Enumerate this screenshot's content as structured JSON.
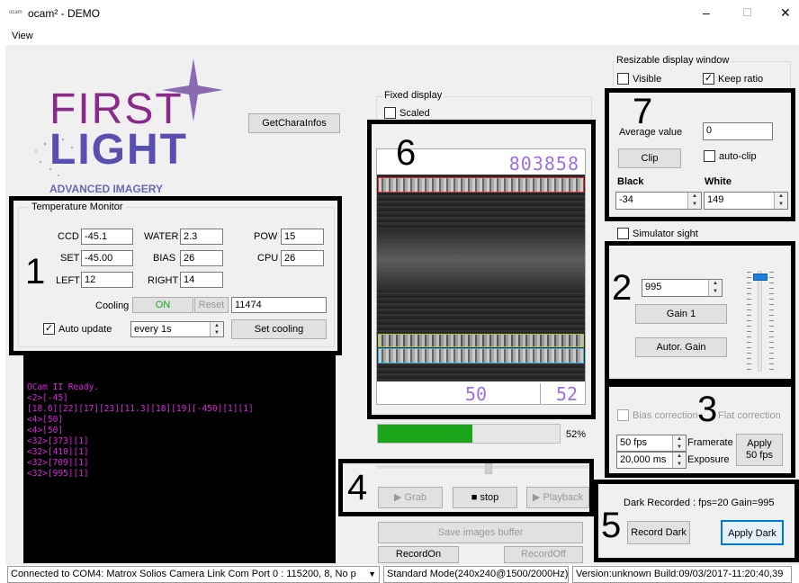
{
  "window": {
    "title": "ocam² - DEMO",
    "app_icon": "app-icon",
    "minimize": "–",
    "maximize": "☐",
    "close": "✕"
  },
  "menu": {
    "view": "View"
  },
  "logo": {
    "line1": "FIRST",
    "line2": "LIGHT",
    "tagline": "ADVANCED IMAGERY"
  },
  "buttons": {
    "get_chara_infos": "GetCharaInfos"
  },
  "temperature": {
    "title": "Temperature Monitor",
    "ccd_label": "CCD",
    "ccd": "-45.1",
    "water_label": "WATER",
    "water": "2.3",
    "pow_label": "POW",
    "pow": "15",
    "set_label": "SET",
    "set": "-45.00",
    "bias_label": "BIAS",
    "bias": "26",
    "cpu_label": "CPU",
    "cpu": "26",
    "left_label": "LEFT",
    "left": "12",
    "right_label": "RIGHT",
    "right": "14",
    "cooling_label": "Cooling",
    "cooling_on": "ON",
    "reset": "Reset",
    "cooling_value": "11474",
    "auto_update": "Auto update",
    "interval": "every 1s",
    "set_cooling": "Set cooling"
  },
  "console": [
    "OCam II Ready.",
    "<2>[-45]",
    "[18.6][22][17][23][11.3][18][19][-450][1][1]",
    "<4>[50]",
    "<4>[50]",
    "<32>[373][1]",
    "<32>[410][1]",
    "<32>[709][1]",
    "<32>[995][1]"
  ],
  "display": {
    "fixed_label": "Fixed display",
    "scaled": "Scaled",
    "frame_counter": "803858",
    "bottom_left": "50",
    "bottom_right": "52"
  },
  "progress": {
    "percent": 52,
    "label": "52%"
  },
  "playback": {
    "grab": "Grab",
    "stop": "stop",
    "playback": "Playback"
  },
  "buffer": {
    "save": "Save images buffer",
    "record_on": "RecordOn",
    "record_off": "RecordOff"
  },
  "resizable": {
    "title": "Resizable display window",
    "visible": "Visible",
    "keep_ratio": "Keep ratio"
  },
  "average": {
    "label": "Average value",
    "value": "0",
    "clip": "Clip",
    "auto_clip": "auto-clip",
    "black_label": "Black",
    "black": "-34",
    "white_label": "White",
    "white": "149"
  },
  "simulator": {
    "label": "Simulator sight"
  },
  "gain": {
    "value": "995",
    "gain1": "Gain 1",
    "auto_gain": "Autor. Gain",
    "slider_level": 0.97
  },
  "correction": {
    "bias": "Bias correction",
    "flat": "Flat correction",
    "framerate_value": "50 fps",
    "framerate_label": "Framerate",
    "exposure_value": "20,000 ms",
    "exposure_label": "Exposure",
    "apply": "Apply\n50 fps"
  },
  "dark": {
    "status": "Dark Recorded : fps=20 Gain=995",
    "record": "Record Dark",
    "apply": "Apply Dark"
  },
  "annotations": {
    "n1": "1",
    "n2": "2",
    "n3": "3",
    "n4": "4",
    "n5": "5",
    "n6": "6",
    "n7": "7"
  },
  "statusbar": {
    "connection": "Connected to COM4: Matrox Solios Camera Link Com Port 0 : 115200, 8, No p",
    "mode": "Standard Mode(240x240@1500/2000Hz)",
    "version": "Version:unknown Build:09/03/2017-11:20:40,39"
  },
  "colors": {
    "accent": "#1aa51a",
    "console_text": "#e021e0",
    "display_digits": "#a070e0",
    "roi_red": "#e03030",
    "roi_yellow": "#b8c040",
    "roi_cyan": "#30b0e0",
    "logo_purple": "#8a2a8a",
    "logo_blue": "#5a4fb0"
  }
}
